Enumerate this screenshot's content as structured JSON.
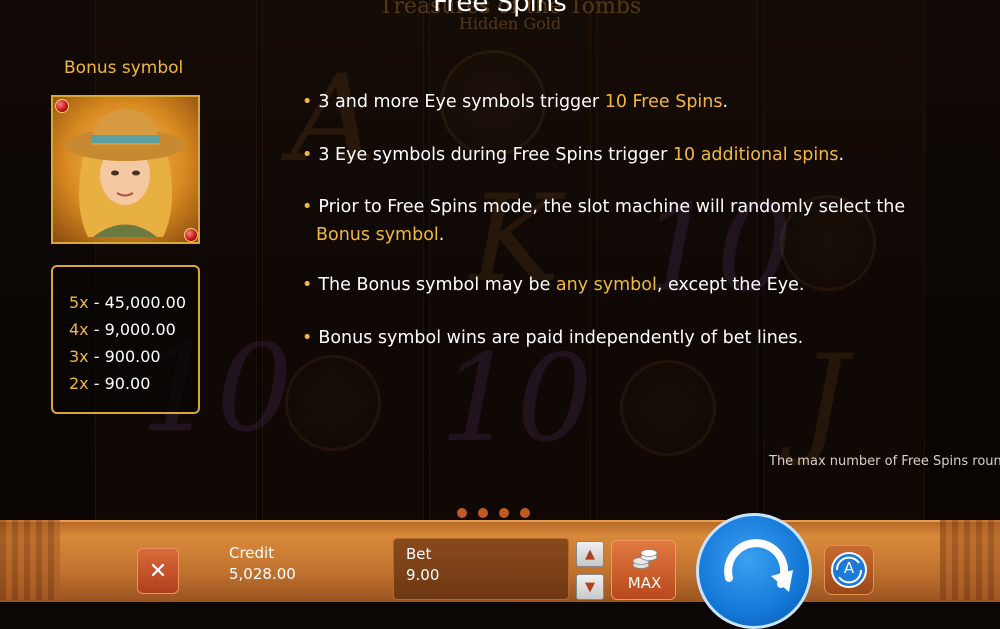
{
  "header": {
    "title": "Free Spins",
    "logo_line1": "Treasures of the Tombs",
    "logo_line2": "Hidden Gold"
  },
  "bonus_panel": {
    "label": "Bonus symbol",
    "paytable": [
      {
        "mult": "5x",
        "value": "45,000.00"
      },
      {
        "mult": "4x",
        "value": "9,000.00"
      },
      {
        "mult": "3x",
        "value": "900.00"
      },
      {
        "mult": "2x",
        "value": "90.00"
      }
    ]
  },
  "rules": [
    {
      "pre": "3 and more Eye symbols trigger ",
      "hl": "10 Free Spins",
      "post": "."
    },
    {
      "pre": "3 Eye symbols during Free Spins trigger ",
      "hl": "10 additional spins",
      "post": "."
    },
    {
      "pre": "Prior to Free Spins mode, the slot machine will randomly select the",
      "hl": "Bonus symbol",
      "post": "."
    },
    {
      "pre": "The Bonus symbol may be ",
      "hl": "any symbol",
      "post": ", except the Eye."
    },
    {
      "pre": "Bonus symbol wins are paid independently of bet lines.",
      "hl": "",
      "post": ""
    }
  ],
  "footnote": "The max number of Free Spins roun",
  "pagination": {
    "pages": 4
  },
  "controls": {
    "credit_label": "Credit",
    "credit_value": "5,028.00",
    "bet_label": "Bet",
    "bet_value": "9.00",
    "max_label": "MAX",
    "auto_label": "A",
    "close_symbol": "✕",
    "up_symbol": "▲",
    "down_symbol": "▼"
  },
  "colors": {
    "accent": "#f0b840",
    "spin": "#1478d8",
    "bar": "#c27430"
  }
}
